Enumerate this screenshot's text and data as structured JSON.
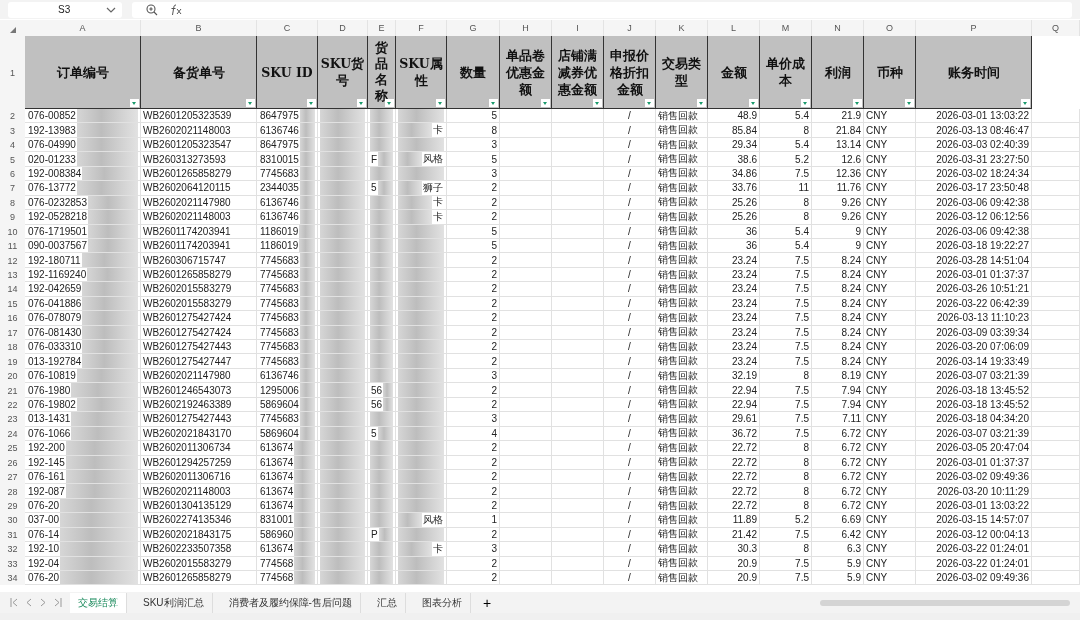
{
  "name_box": "S3",
  "header_row_number": "1",
  "columns": [
    {
      "letter": "A",
      "header": "订单编号",
      "kind": "masked"
    },
    {
      "letter": "B",
      "header": "备货单号",
      "kind": "text"
    },
    {
      "letter": "C",
      "header": "SKU ID",
      "kind": "masked"
    },
    {
      "letter": "D",
      "header": "SKU货号",
      "kind": "masked"
    },
    {
      "letter": "E",
      "header": "货品名称",
      "kind": "masked"
    },
    {
      "letter": "F",
      "header": "SKU属性",
      "kind": "masked_tail"
    },
    {
      "letter": "G",
      "header": "数量",
      "kind": "number"
    },
    {
      "letter": "H",
      "header": "单品卷优惠金额",
      "kind": "number"
    },
    {
      "letter": "I",
      "header": "店铺满减券优惠金额",
      "kind": "number"
    },
    {
      "letter": "J",
      "header": "申报价格折扣金额",
      "kind": "center"
    },
    {
      "letter": "K",
      "header": "交易类型",
      "kind": "text"
    },
    {
      "letter": "L",
      "header": "金额",
      "kind": "number"
    },
    {
      "letter": "M",
      "header": "单价成本",
      "kind": "number"
    },
    {
      "letter": "N",
      "header": "利润",
      "kind": "number"
    },
    {
      "letter": "O",
      "header": "币种",
      "kind": "text"
    },
    {
      "letter": "P",
      "header": "账务时间",
      "kind": "number"
    },
    {
      "letter": "Q"
    }
  ],
  "rows": [
    {
      "row": "2",
      "order_no": "076-00852",
      "stock_order_no": "WB2601205323539",
      "sku_id": "8647975",
      "qty": "5",
      "declared_price_discount": "/",
      "transaction_type": "销售回款",
      "amount": "48.9",
      "unit_cost": "5.4",
      "profit": "21.9",
      "currency": "CNY",
      "posted_time": "2026-03-01 13:03:22"
    },
    {
      "row": "3",
      "order_no": "192-13983",
      "stock_order_no": "WB2602021148003",
      "sku_id": "6136746",
      "sku_attr": "卡",
      "qty": "8",
      "declared_price_discount": "/",
      "transaction_type": "销售回款",
      "amount": "85.84",
      "unit_cost": "8",
      "profit": "21.84",
      "currency": "CNY",
      "posted_time": "2026-03-13 08:46:47"
    },
    {
      "row": "4",
      "order_no": "076-04990",
      "stock_order_no": "WB2601205323547",
      "sku_id": "8647975",
      "qty": "3",
      "declared_price_discount": "/",
      "transaction_type": "销售回款",
      "amount": "29.34",
      "unit_cost": "5.4",
      "profit": "13.14",
      "currency": "CNY",
      "posted_time": "2026-03-03 02:40:39"
    },
    {
      "row": "5",
      "order_no": "020-01233",
      "stock_order_no": "WB260313273593",
      "sku_id": "8310015",
      "sku_name": "F",
      "sku_attr": "风格",
      "qty": "5",
      "declared_price_discount": "/",
      "transaction_type": "销售回款",
      "amount": "38.6",
      "unit_cost": "5.2",
      "profit": "12.6",
      "currency": "CNY",
      "posted_time": "2026-03-31 23:27:50"
    },
    {
      "row": "6",
      "order_no": "192-008384",
      "stock_order_no": "WB2601265858279",
      "sku_id": "7745683",
      "qty": "3",
      "declared_price_discount": "/",
      "transaction_type": "销售回款",
      "amount": "34.86",
      "unit_cost": "7.5",
      "profit": "12.36",
      "currency": "CNY",
      "posted_time": "2026-03-02 18:24:34"
    },
    {
      "row": "7",
      "order_no": "076-13772",
      "stock_order_no": "WB2602064120115",
      "sku_id": "2344035",
      "sku_name": "5",
      "sku_attr": "狮子",
      "qty": "2",
      "declared_price_discount": "/",
      "transaction_type": "销售回款",
      "amount": "33.76",
      "unit_cost": "11",
      "profit": "11.76",
      "currency": "CNY",
      "posted_time": "2026-03-17 23:50:48"
    },
    {
      "row": "8",
      "order_no": "076-0232853",
      "stock_order_no": "WB2602021147980",
      "sku_id": "6136746",
      "sku_attr": "卡",
      "qty": "2",
      "declared_price_discount": "/",
      "transaction_type": "销售回款",
      "amount": "25.26",
      "unit_cost": "8",
      "profit": "9.26",
      "currency": "CNY",
      "posted_time": "2026-03-06 09:42:38"
    },
    {
      "row": "9",
      "order_no": "192-0528218",
      "stock_order_no": "WB2602021148003",
      "sku_id": "6136746",
      "sku_attr": "卡",
      "qty": "2",
      "declared_price_discount": "/",
      "transaction_type": "销售回款",
      "amount": "25.26",
      "unit_cost": "8",
      "profit": "9.26",
      "currency": "CNY",
      "posted_time": "2026-03-12 06:12:56"
    },
    {
      "row": "10",
      "order_no": "076-1719501",
      "stock_order_no": "WB2601174203941",
      "sku_id": "1186019",
      "qty": "5",
      "declared_price_discount": "/",
      "transaction_type": "销售回款",
      "amount": "36",
      "unit_cost": "5.4",
      "profit": "9",
      "currency": "CNY",
      "posted_time": "2026-03-06 09:42:38"
    },
    {
      "row": "11",
      "order_no": "090-0037567",
      "stock_order_no": "WB2601174203941",
      "sku_id": "1186019",
      "qty": "5",
      "declared_price_discount": "/",
      "transaction_type": "销售回款",
      "amount": "36",
      "unit_cost": "5.4",
      "profit": "9",
      "currency": "CNY",
      "posted_time": "2026-03-18 19:22:27"
    },
    {
      "row": "12",
      "order_no": "192-180711",
      "stock_order_no": "WB260306715747",
      "sku_id": "7745683",
      "qty": "2",
      "declared_price_discount": "/",
      "transaction_type": "销售回款",
      "amount": "23.24",
      "unit_cost": "7.5",
      "profit": "8.24",
      "currency": "CNY",
      "posted_time": "2026-03-28 14:51:04"
    },
    {
      "row": "13",
      "order_no": "192-1169240",
      "stock_order_no": "WB2601265858279",
      "sku_id": "7745683",
      "qty": "2",
      "declared_price_discount": "/",
      "transaction_type": "销售回款",
      "amount": "23.24",
      "unit_cost": "7.5",
      "profit": "8.24",
      "currency": "CNY",
      "posted_time": "2026-03-01 01:37:37"
    },
    {
      "row": "14",
      "order_no": "192-042659",
      "stock_order_no": "WB2602015583279",
      "sku_id": "7745683",
      "qty": "2",
      "declared_price_discount": "/",
      "transaction_type": "销售回款",
      "amount": "23.24",
      "unit_cost": "7.5",
      "profit": "8.24",
      "currency": "CNY",
      "posted_time": "2026-03-26 10:51:21"
    },
    {
      "row": "15",
      "order_no": "076-041886",
      "stock_order_no": "WB2602015583279",
      "sku_id": "7745683",
      "qty": "2",
      "declared_price_discount": "/",
      "transaction_type": "销售回款",
      "amount": "23.24",
      "unit_cost": "7.5",
      "profit": "8.24",
      "currency": "CNY",
      "posted_time": "2026-03-22 06:42:39"
    },
    {
      "row": "16",
      "order_no": "076-078079",
      "stock_order_no": "WB2601275427424",
      "sku_id": "7745683",
      "qty": "2",
      "declared_price_discount": "/",
      "transaction_type": "销售回款",
      "amount": "23.24",
      "unit_cost": "7.5",
      "profit": "8.24",
      "currency": "CNY",
      "posted_time": "2026-03-13 11:10:23"
    },
    {
      "row": "17",
      "order_no": "076-081430",
      "stock_order_no": "WB2601275427424",
      "sku_id": "7745683",
      "qty": "2",
      "declared_price_discount": "/",
      "transaction_type": "销售回款",
      "amount": "23.24",
      "unit_cost": "7.5",
      "profit": "8.24",
      "currency": "CNY",
      "posted_time": "2026-03-09 03:39:34"
    },
    {
      "row": "18",
      "order_no": "076-033310",
      "stock_order_no": "WB2601275427443",
      "sku_id": "7745683",
      "qty": "2",
      "declared_price_discount": "/",
      "transaction_type": "销售回款",
      "amount": "23.24",
      "unit_cost": "7.5",
      "profit": "8.24",
      "currency": "CNY",
      "posted_time": "2026-03-20 07:06:09"
    },
    {
      "row": "19",
      "order_no": "013-192784",
      "stock_order_no": "WB2601275427447",
      "sku_id": "7745683",
      "qty": "2",
      "declared_price_discount": "/",
      "transaction_type": "销售回款",
      "amount": "23.24",
      "unit_cost": "7.5",
      "profit": "8.24",
      "currency": "CNY",
      "posted_time": "2026-03-14 19:33:49"
    },
    {
      "row": "20",
      "order_no": "076-10819",
      "stock_order_no": "WB2602021147980",
      "sku_id": "6136746",
      "qty": "3",
      "declared_price_discount": "/",
      "transaction_type": "销售回款",
      "amount": "32.19",
      "unit_cost": "8",
      "profit": "8.19",
      "currency": "CNY",
      "posted_time": "2026-03-07 03:21:39"
    },
    {
      "row": "21",
      "order_no": "076-1980",
      "stock_order_no": "WB2601246543073",
      "sku_id": "1295006",
      "sku_name": "56",
      "qty": "2",
      "declared_price_discount": "/",
      "transaction_type": "销售回款",
      "amount": "22.94",
      "unit_cost": "7.5",
      "profit": "7.94",
      "currency": "CNY",
      "posted_time": "2026-03-18 13:45:52"
    },
    {
      "row": "22",
      "order_no": "076-19802",
      "stock_order_no": "WB2602192463389",
      "sku_id": "5869604",
      "sku_name": "56",
      "qty": "2",
      "declared_price_discount": "/",
      "transaction_type": "销售回款",
      "amount": "22.94",
      "unit_cost": "7.5",
      "profit": "7.94",
      "currency": "CNY",
      "posted_time": "2026-03-18 13:45:52"
    },
    {
      "row": "23",
      "order_no": "013-1431",
      "stock_order_no": "WB2601275427443",
      "sku_id": "7745683",
      "qty": "3",
      "declared_price_discount": "/",
      "transaction_type": "销售回款",
      "amount": "29.61",
      "unit_cost": "7.5",
      "profit": "7.11",
      "currency": "CNY",
      "posted_time": "2026-03-18 04:34:20"
    },
    {
      "row": "24",
      "order_no": "076-1066",
      "stock_order_no": "WB2602021843170",
      "sku_id": "5869604",
      "sku_name": "5",
      "qty": "4",
      "declared_price_discount": "/",
      "transaction_type": "销售回款",
      "amount": "36.72",
      "unit_cost": "7.5",
      "profit": "6.72",
      "currency": "CNY",
      "posted_time": "2026-03-07 03:21:39"
    },
    {
      "row": "25",
      "order_no": "192-200",
      "stock_order_no": "WB2602011306734",
      "sku_id": "613674",
      "qty": "2",
      "declared_price_discount": "/",
      "transaction_type": "销售回款",
      "amount": "22.72",
      "unit_cost": "8",
      "profit": "6.72",
      "currency": "CNY",
      "posted_time": "2026-03-05 20:47:04"
    },
    {
      "row": "26",
      "order_no": "192-145",
      "stock_order_no": "WB2601294257259",
      "sku_id": "613674",
      "qty": "2",
      "declared_price_discount": "/",
      "transaction_type": "销售回款",
      "amount": "22.72",
      "unit_cost": "8",
      "profit": "6.72",
      "currency": "CNY",
      "posted_time": "2026-03-01 01:37:37"
    },
    {
      "row": "27",
      "order_no": "076-161",
      "stock_order_no": "WB2602011306716",
      "sku_id": "613674",
      "qty": "2",
      "declared_price_discount": "/",
      "transaction_type": "销售回款",
      "amount": "22.72",
      "unit_cost": "8",
      "profit": "6.72",
      "currency": "CNY",
      "posted_time": "2026-03-02 09:49:36"
    },
    {
      "row": "28",
      "order_no": "192-087",
      "stock_order_no": "WB2602021148003",
      "sku_id": "613674",
      "qty": "2",
      "declared_price_discount": "/",
      "transaction_type": "销售回款",
      "amount": "22.72",
      "unit_cost": "8",
      "profit": "6.72",
      "currency": "CNY",
      "posted_time": "2026-03-20 10:11:29"
    },
    {
      "row": "29",
      "order_no": "076-20",
      "stock_order_no": "WB2601304135129",
      "sku_id": "613674",
      "qty": "2",
      "declared_price_discount": "/",
      "transaction_type": "销售回款",
      "amount": "22.72",
      "unit_cost": "8",
      "profit": "6.72",
      "currency": "CNY",
      "posted_time": "2026-03-01 13:03:22"
    },
    {
      "row": "30",
      "order_no": "037-00",
      "stock_order_no": "WB2602274135346",
      "sku_id": "831001",
      "sku_attr": "风格",
      "qty": "1",
      "declared_price_discount": "/",
      "transaction_type": "销售回款",
      "amount": "11.89",
      "unit_cost": "5.2",
      "profit": "6.69",
      "currency": "CNY",
      "posted_time": "2026-03-15 14:57:07"
    },
    {
      "row": "31",
      "order_no": "076-14",
      "stock_order_no": "WB2602021843175",
      "sku_id": "586960",
      "sku_name": "P",
      "qty": "2",
      "declared_price_discount": "/",
      "transaction_type": "销售回款",
      "amount": "21.42",
      "unit_cost": "7.5",
      "profit": "6.42",
      "currency": "CNY",
      "posted_time": "2026-03-12 00:04:13"
    },
    {
      "row": "32",
      "order_no": "192-10",
      "stock_order_no": "WB2602233507358",
      "sku_id": "613674",
      "sku_attr": "卡",
      "qty": "3",
      "declared_price_discount": "/",
      "transaction_type": "销售回款",
      "amount": "30.3",
      "unit_cost": "8",
      "profit": "6.3",
      "currency": "CNY",
      "posted_time": "2026-03-22 01:24:01"
    },
    {
      "row": "33",
      "order_no": "192-04",
      "stock_order_no": "WB2602015583279",
      "sku_id": "774568",
      "qty": "2",
      "declared_price_discount": "/",
      "transaction_type": "销售回款",
      "amount": "20.9",
      "unit_cost": "7.5",
      "profit": "5.9",
      "currency": "CNY",
      "posted_time": "2026-03-22 01:24:01"
    },
    {
      "row": "34",
      "order_no": "076-20",
      "stock_order_no": "WB2601265858279",
      "sku_id": "774568",
      "qty": "2",
      "declared_price_discount": "/",
      "transaction_type": "销售回款",
      "amount": "20.9",
      "unit_cost": "7.5",
      "profit": "5.9",
      "currency": "CNY",
      "posted_time": "2026-03-02 09:49:36"
    }
  ],
  "sheet_tabs": [
    {
      "label": "交易结算",
      "selected": true
    },
    {
      "label": "SKU利润汇总",
      "selected": false
    },
    {
      "label": "消费者及履约保障-售后问题",
      "selected": false
    },
    {
      "label": "汇总",
      "selected": false
    },
    {
      "label": "图表分析",
      "selected": false
    }
  ],
  "add_sheet": "+"
}
